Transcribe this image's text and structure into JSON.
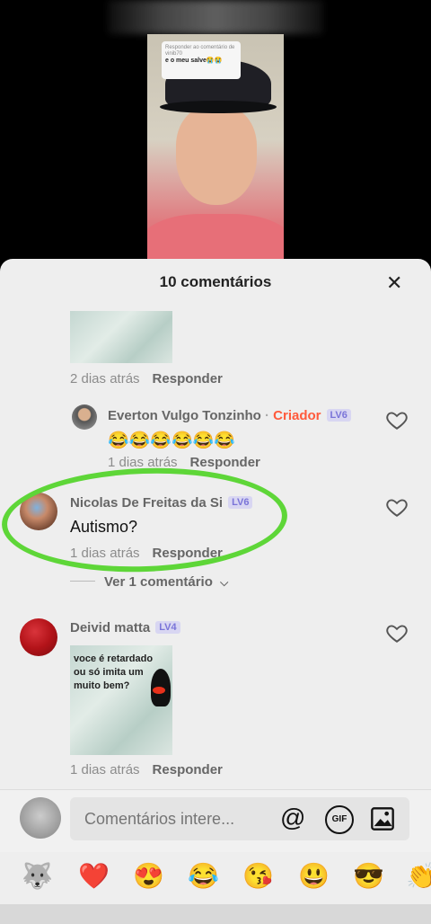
{
  "video": {
    "sticker": {
      "reply_line": "Responder ao comentário de",
      "reply_user": "vinib70",
      "reply_text": "e o meu salve😭😭"
    }
  },
  "sheet": {
    "title": "10 comentários",
    "close_icon": "close-icon"
  },
  "comments": {
    "first": {
      "time": "2 dias atrás",
      "reply": "Responder"
    },
    "everton": {
      "name": "Everton Vulgo Tonzinho",
      "sep": "·",
      "creator": "Criador",
      "level": "LV6",
      "text": "😂😂😂😂😂😂",
      "time": "1 dias atrás",
      "reply": "Responder"
    },
    "nicolas": {
      "name": "Nicolas De Freitas da Si",
      "level": "LV6",
      "text": "Autismo?",
      "time": "1 dias atrás",
      "reply": "Responder",
      "view_replies": "Ver 1 comentário"
    },
    "deivid": {
      "name": "Deivid matta",
      "level": "LV4",
      "image_text": "voce é retardado ou só imita um muito bem?",
      "time": "1 dias atrás",
      "reply": "Responder"
    }
  },
  "input": {
    "placeholder": "Comentários intere..."
  },
  "emojis": [
    "🐺",
    "❤️",
    "😍",
    "😂",
    "😘",
    "😃",
    "😎",
    "👏"
  ],
  "colors": {
    "creator": "#ff5a3c",
    "badge_bg": "#d8d6f2",
    "badge_text": "#7a74d8",
    "highlight": "#5ed638"
  }
}
